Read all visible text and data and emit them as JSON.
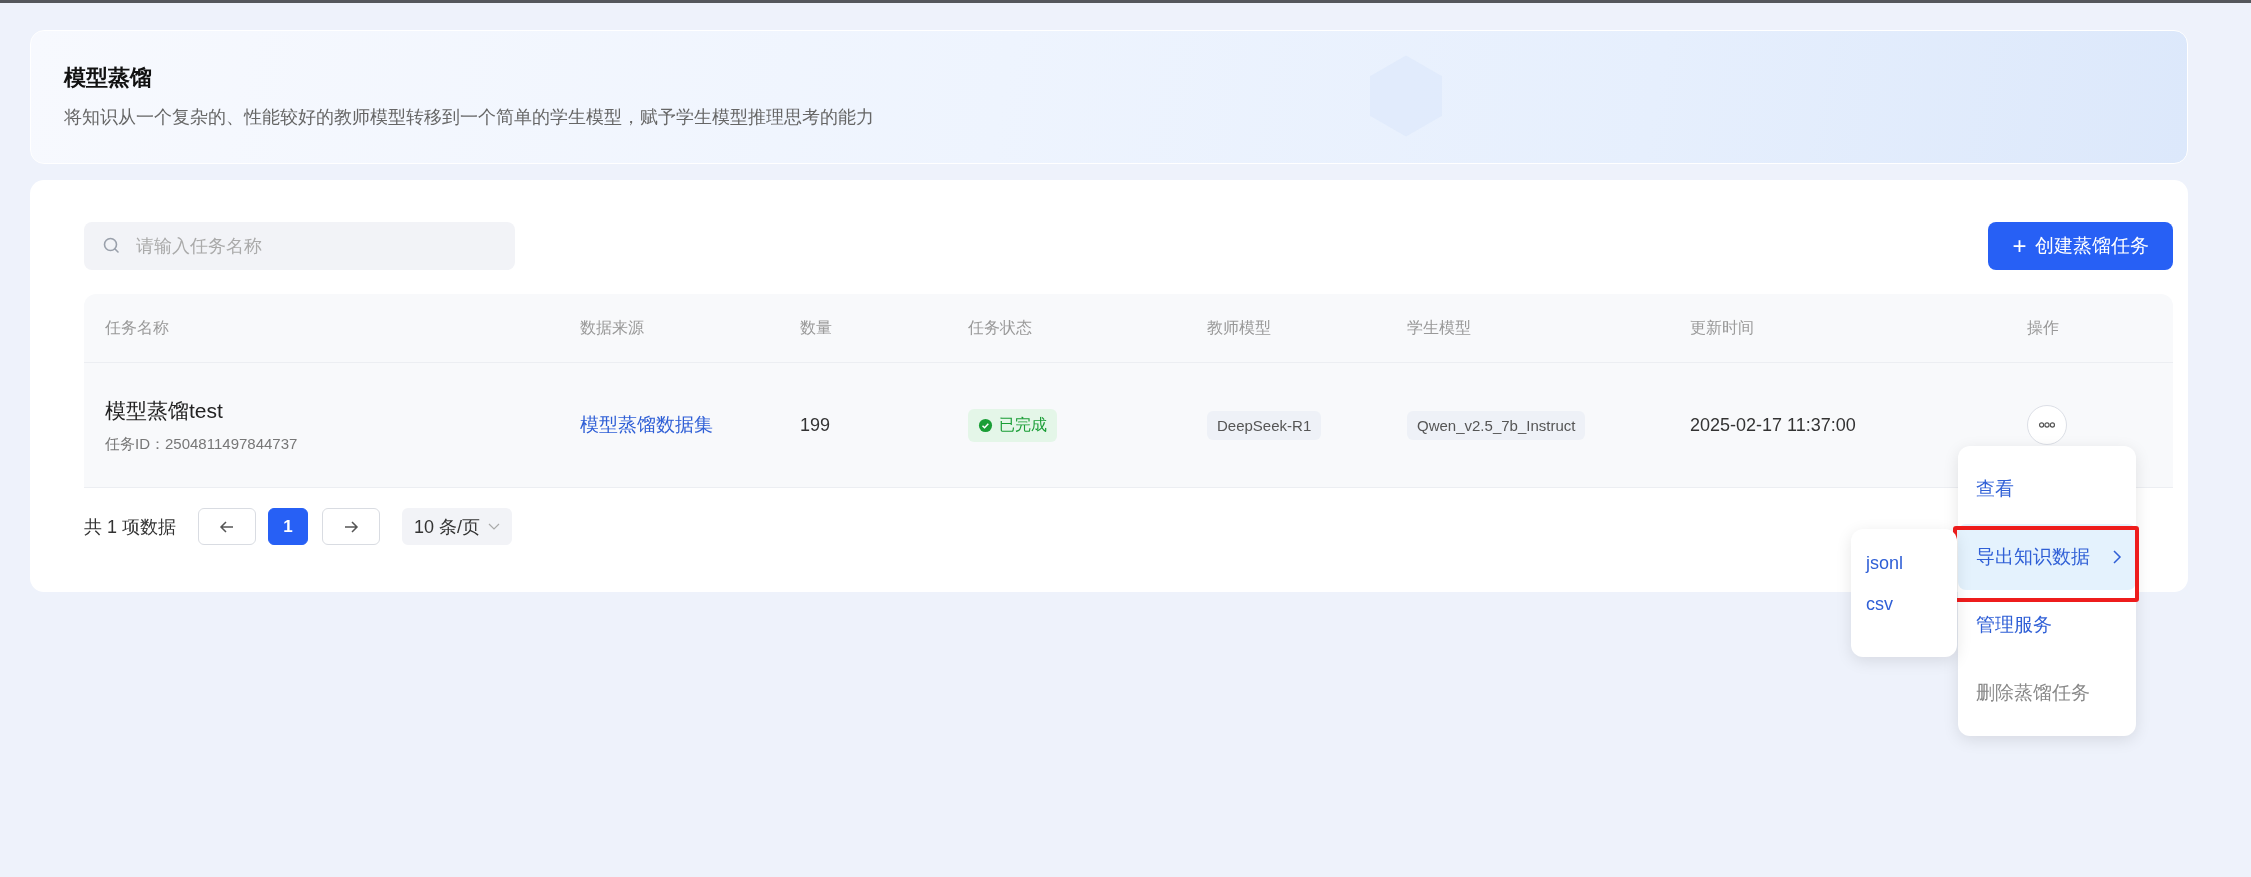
{
  "header": {
    "title": "模型蒸馏",
    "subtitle": "将知识从一个复杂的、性能较好的教师模型转移到一个简单的学生模型，赋予学生模型推理思考的能力"
  },
  "search": {
    "placeholder": "请输入任务名称"
  },
  "create_button": {
    "icon": "+",
    "label": "创建蒸馏任务"
  },
  "table": {
    "columns": [
      "任务名称",
      "数据来源",
      "数量",
      "任务状态",
      "教师模型",
      "学生模型",
      "更新时间",
      "操作"
    ],
    "rows": [
      {
        "name": "模型蒸馏test",
        "task_id": "任务ID：2504811497844737",
        "source": "模型蒸馏数据集",
        "count": "199",
        "status": "已完成",
        "teacher": "DeepSeek-R1",
        "student": "Qwen_v2.5_7b_Instruct",
        "updated": "2025-02-17 11:37:00"
      }
    ]
  },
  "pagination": {
    "total": "共 1 项数据",
    "pages": [
      {
        "label": "1",
        "selected": true
      }
    ],
    "page_size": "10 条/页"
  },
  "action_menu": {
    "items": [
      {
        "label": "查看",
        "selected": false,
        "disabled": false,
        "has_submenu": false,
        "annotated": false
      },
      {
        "label": "导出知识数据",
        "selected": true,
        "disabled": false,
        "has_submenu": true,
        "annotated": true
      },
      {
        "label": "管理服务",
        "selected": false,
        "disabled": false,
        "has_submenu": false,
        "annotated": false
      },
      {
        "label": "删除蒸馏任务",
        "selected": false,
        "disabled": true,
        "has_submenu": false,
        "annotated": false
      }
    ],
    "submenu": [
      "jsonl",
      "csv"
    ]
  }
}
